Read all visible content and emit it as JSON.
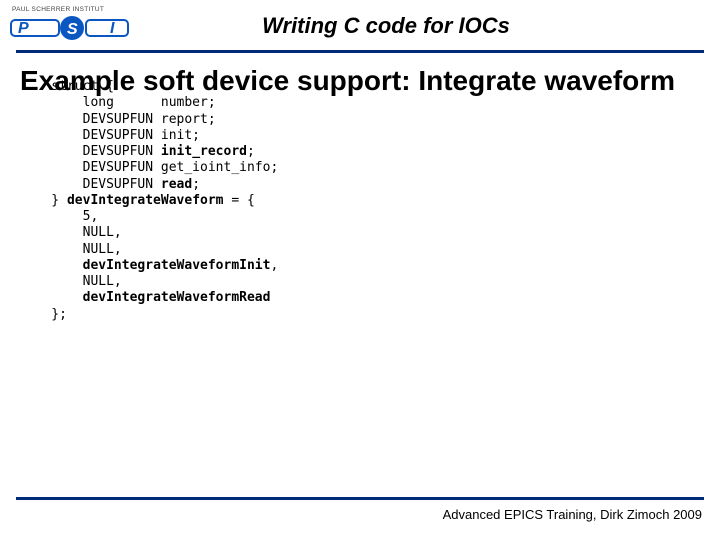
{
  "logo": {
    "top_text": "PAUL SCHERRER INSTITUT",
    "mark_text": "PSI"
  },
  "header_title": "Writing C code for IOCs",
  "slide_title": "Example soft device support: Integrate waveform",
  "code_lines": [
    {
      "indent": 1,
      "pre": "struct {",
      "bold": "",
      "post": ""
    },
    {
      "indent": 2,
      "pre": "long      number;",
      "bold": "",
      "post": ""
    },
    {
      "indent": 2,
      "pre": "DEVSUPFUN report;",
      "bold": "",
      "post": ""
    },
    {
      "indent": 2,
      "pre": "DEVSUPFUN init;",
      "bold": "",
      "post": ""
    },
    {
      "indent": 2,
      "pre": "DEVSUPFUN ",
      "bold": "init_record",
      "post": ";"
    },
    {
      "indent": 2,
      "pre": "DEVSUPFUN get_ioint_info;",
      "bold": "",
      "post": ""
    },
    {
      "indent": 2,
      "pre": "DEVSUPFUN ",
      "bold": "read",
      "post": ";"
    },
    {
      "indent": 1,
      "pre": "} ",
      "bold": "devIntegrateWaveform",
      "post": " = {"
    },
    {
      "indent": 2,
      "pre": "5,",
      "bold": "",
      "post": ""
    },
    {
      "indent": 2,
      "pre": "NULL,",
      "bold": "",
      "post": ""
    },
    {
      "indent": 2,
      "pre": "NULL,",
      "bold": "",
      "post": ""
    },
    {
      "indent": 2,
      "pre": "",
      "bold": "devIntegrateWaveformInit",
      "post": ","
    },
    {
      "indent": 2,
      "pre": "NULL,",
      "bold": "",
      "post": ""
    },
    {
      "indent": 2,
      "pre": "",
      "bold": "devIntegrateWaveformRead",
      "post": ""
    },
    {
      "indent": 1,
      "pre": "};",
      "bold": "",
      "post": ""
    }
  ],
  "footer": "Advanced EPICS Training, Dirk Zimoch 2009"
}
